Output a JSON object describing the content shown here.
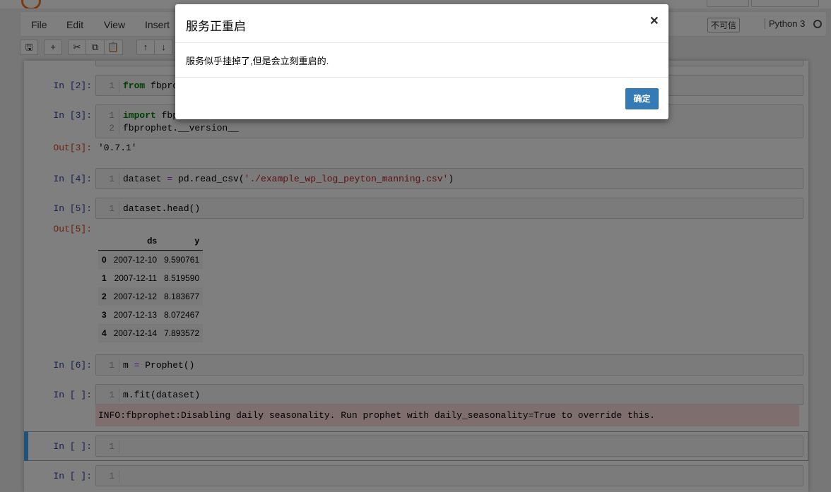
{
  "header": {
    "notebook_title": ""
  },
  "menubar": {
    "items": [
      "File",
      "Edit",
      "View",
      "Insert"
    ],
    "trust_label": "不可信",
    "kernel_name": "Python 3"
  },
  "toolbar": {
    "icons": [
      "save-icon",
      "plus-icon",
      "cut-icon",
      "copy-icon",
      "paste-icon",
      "arrow-up-icon",
      "arrow-down-icon"
    ],
    "glyphs": [
      "🖫",
      "+",
      "✂",
      "⧉",
      "📋",
      "↑",
      "↓"
    ]
  },
  "cells": {
    "c2": {
      "prompt": "In  [2]:",
      "lines": [
        {
          "n": "1",
          "kw": "from",
          "rest": " fbprop"
        }
      ]
    },
    "c3": {
      "prompt": "In  [3]:",
      "lines": [
        {
          "n": "1",
          "kw": "import",
          "rest": " fbpr"
        },
        {
          "n": "2",
          "text": "fbprophet.__version__"
        }
      ],
      "out_prompt": "Out[3]:",
      "out_text": "'0.7.1'"
    },
    "c4": {
      "prompt": "In  [4]:",
      "n": "1",
      "code_a": "dataset ",
      "code_op": "=",
      "code_b": " pd.read_csv(",
      "code_str": "'./example_wp_log_peyton_manning.csv'",
      "code_c": ")"
    },
    "c5": {
      "prompt": "In  [5]:",
      "n": "1",
      "code": "dataset.head()",
      "out_prompt": "Out[5]:"
    },
    "c6": {
      "prompt": "In  [6]:",
      "n": "1",
      "code_a": "m ",
      "code_op": "=",
      "code_b": " Prophet()"
    },
    "c7": {
      "prompt": "In  [ ]:",
      "n": "1",
      "code": "m.fit(dataset)",
      "stderr": "INFO:fbprophet:Disabling daily seasonality. Run prophet with daily_seasonality=True to override this."
    },
    "c8": {
      "prompt": "In  [ ]:",
      "n": "1"
    },
    "c9": {
      "prompt": "In  [ ]:",
      "n": "1"
    }
  },
  "dataframe": {
    "columns": [
      "",
      "ds",
      "y"
    ],
    "rows": [
      [
        "0",
        "2007-12-10",
        "9.590761"
      ],
      [
        "1",
        "2007-12-11",
        "8.519590"
      ],
      [
        "2",
        "2007-12-12",
        "8.183677"
      ],
      [
        "3",
        "2007-12-13",
        "8.072467"
      ],
      [
        "4",
        "2007-12-14",
        "7.893572"
      ]
    ]
  },
  "modal": {
    "title": "服务正重启",
    "close_glyph": "×",
    "body": "服务似乎挂掉了,但是会立刻重启的.",
    "ok_label": "确定"
  }
}
